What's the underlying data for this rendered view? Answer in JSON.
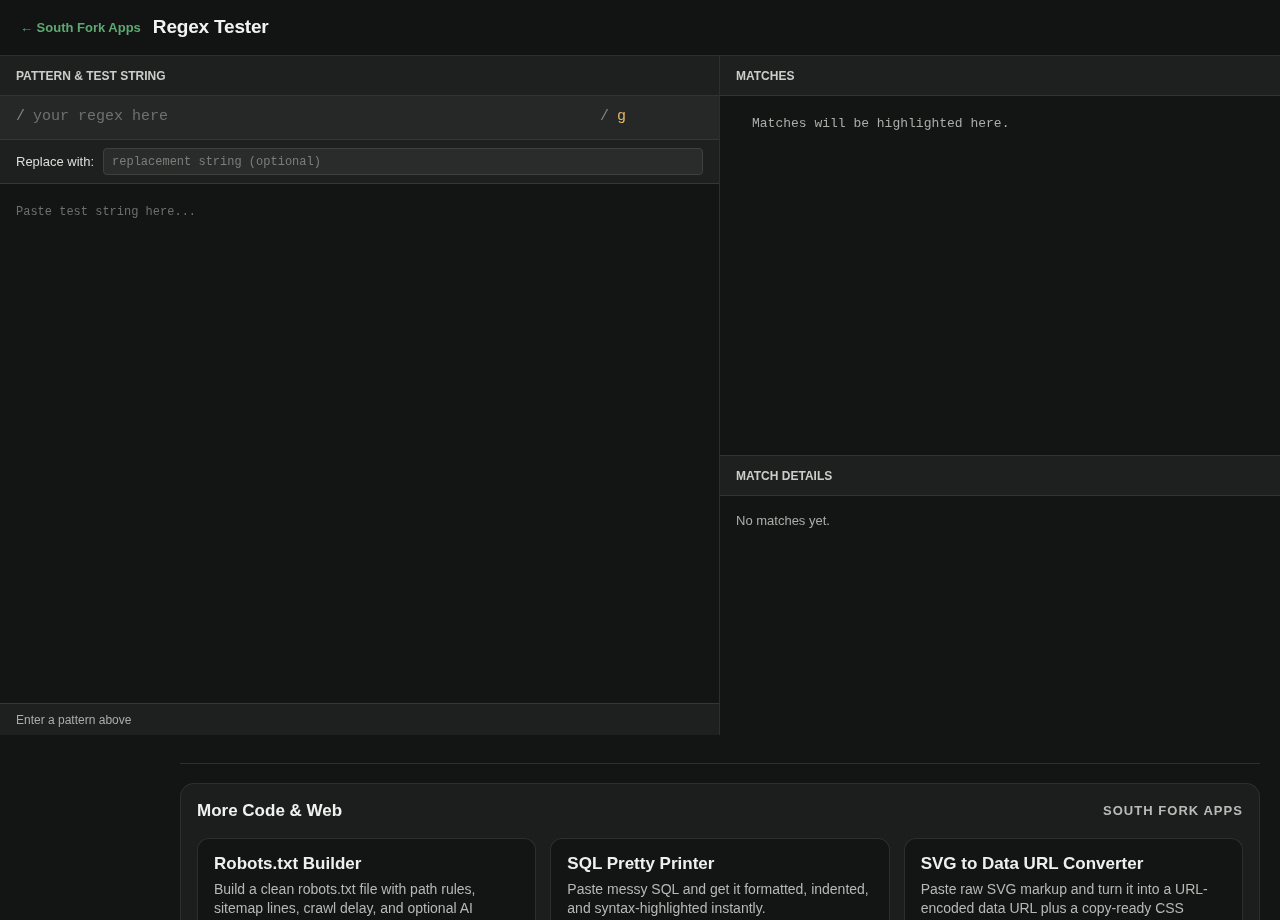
{
  "header": {
    "back_link": "← South Fork Apps",
    "title": "Regex Tester"
  },
  "pattern_panel": {
    "title": "PATTERN & TEST STRING",
    "regex": {
      "open_delimiter": "/",
      "placeholder": "your regex here",
      "close_delimiter": "/",
      "flags": "g"
    },
    "replace": {
      "label": "Replace with:",
      "placeholder": "replacement string (optional)"
    },
    "test_string": {
      "placeholder": "Paste test string here..."
    },
    "status": "Enter a pattern above"
  },
  "matches_panel": {
    "title": "MATCHES",
    "empty_text": "Matches will be highlighted here."
  },
  "details_panel": {
    "title": "MATCH DETAILS",
    "empty_text": "No matches yet."
  },
  "more_section": {
    "title": "More Code & Web",
    "brand": "SOUTH FORK APPS",
    "cards": [
      {
        "title": "Robots.txt Builder",
        "description": "Build a clean robots.txt file with path rules, sitemap lines, crawl delay, and optional AI"
      },
      {
        "title": "SQL Pretty Printer",
        "description": "Paste messy SQL and get it formatted, indented, and syntax-highlighted instantly."
      },
      {
        "title": "SVG to Data URL Converter",
        "description": "Paste raw SVG markup and turn it into a URL-encoded data URL plus a copy-ready CSS"
      }
    ]
  }
}
